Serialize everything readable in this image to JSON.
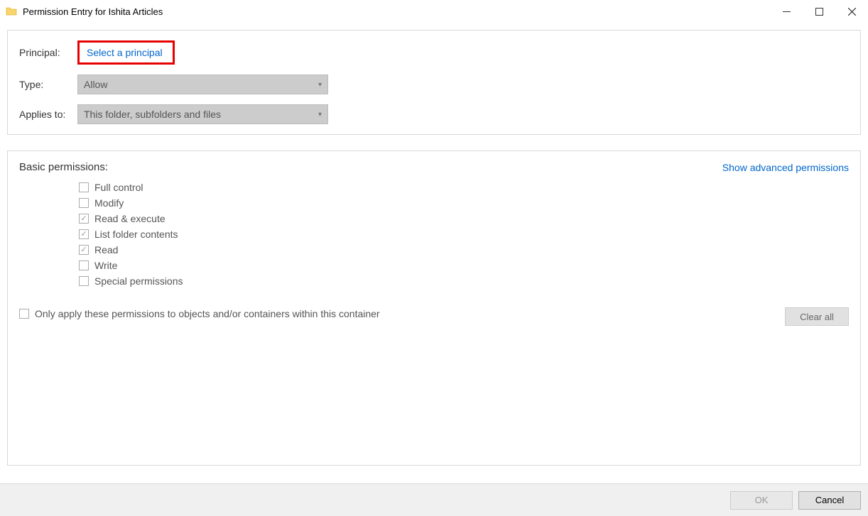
{
  "window": {
    "title": "Permission Entry for Ishita Articles"
  },
  "top": {
    "principal_label": "Principal:",
    "principal_link": "Select a principal",
    "type_label": "Type:",
    "type_value": "Allow",
    "applies_label": "Applies to:",
    "applies_value": "This folder, subfolders and files"
  },
  "perms": {
    "header": "Basic permissions:",
    "advanced_link": "Show advanced permissions",
    "items": [
      {
        "label": "Full control",
        "checked": false
      },
      {
        "label": "Modify",
        "checked": false
      },
      {
        "label": "Read & execute",
        "checked": true
      },
      {
        "label": "List folder contents",
        "checked": true
      },
      {
        "label": "Read",
        "checked": true
      },
      {
        "label": "Write",
        "checked": false
      },
      {
        "label": "Special permissions",
        "checked": false
      }
    ],
    "only_apply": "Only apply these permissions to objects and/or containers within this container",
    "clear_all": "Clear all"
  },
  "footer": {
    "ok": "OK",
    "cancel": "Cancel"
  }
}
